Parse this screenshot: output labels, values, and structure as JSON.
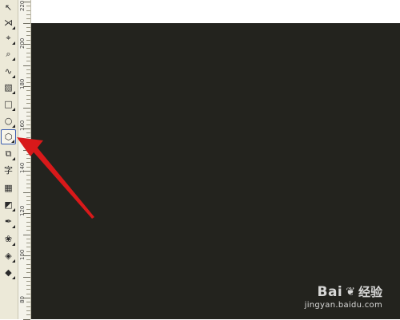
{
  "toolbox": {
    "tools": [
      {
        "name": "pick-tool",
        "glyph": "↖"
      },
      {
        "name": "shape-tool",
        "glyph": "⋊"
      },
      {
        "name": "crop-tool",
        "glyph": "⌖"
      },
      {
        "name": "zoom-tool",
        "glyph": "⌕"
      },
      {
        "name": "freehand-tool",
        "glyph": "∿"
      },
      {
        "name": "smart-fill-tool",
        "glyph": "▧"
      },
      {
        "name": "rectangle-tool",
        "glyph": "□"
      },
      {
        "name": "ellipse-tool",
        "glyph": "○"
      },
      {
        "name": "polygon-tool",
        "glyph": "⬡"
      },
      {
        "name": "basic-shapes-tool",
        "glyph": "⧉"
      },
      {
        "name": "text-tool",
        "glyph": "字"
      },
      {
        "name": "table-tool",
        "glyph": "▦"
      },
      {
        "name": "interactive-blend-tool",
        "glyph": "◩"
      },
      {
        "name": "eyedropper-tool",
        "glyph": "✒"
      },
      {
        "name": "outline-pen-tool",
        "glyph": "❀"
      },
      {
        "name": "fill-tool",
        "glyph": "◈"
      },
      {
        "name": "interactive-fill-tool",
        "glyph": "◆"
      }
    ]
  },
  "ruler": {
    "labels": [
      "220",
      "200",
      "180",
      "160",
      "140",
      "120",
      "100",
      "80"
    ]
  },
  "colors": {
    "canvas": "#23231e",
    "arrow": "#d8191a",
    "toolbox": "#ece9d8"
  },
  "watermark": {
    "brand": "Bai",
    "paw": "❦",
    "jingyan": "经验",
    "url": "jingyan.baidu.com"
  }
}
